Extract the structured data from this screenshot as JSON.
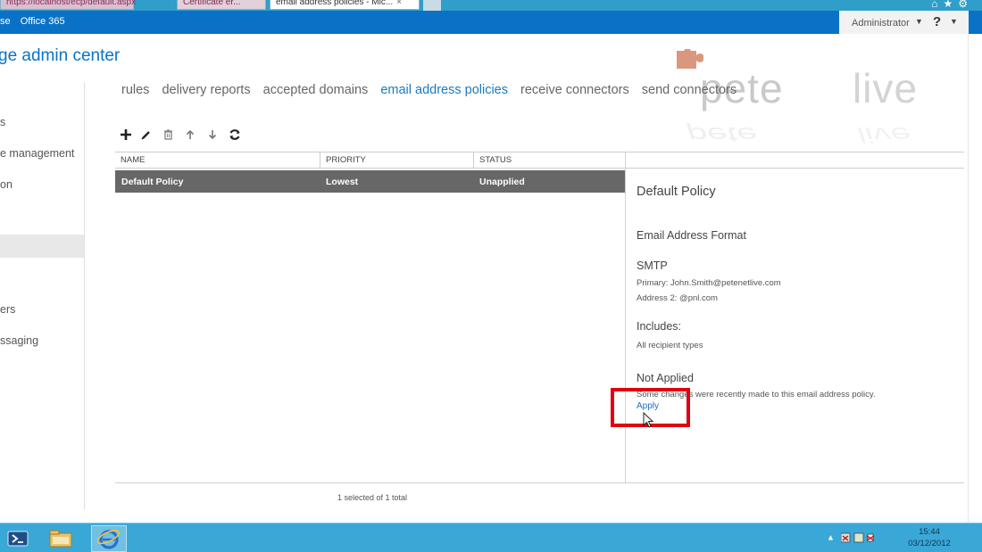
{
  "browser": {
    "tabs": [
      {
        "label": "https://localhost/ecp/default.aspx"
      },
      {
        "label": "Certificate er..."
      },
      {
        "label": "email address policies - Mic..."
      }
    ]
  },
  "topbar": {
    "nav": [
      "se",
      "Office 365"
    ],
    "user": "Administrator",
    "help": "?"
  },
  "app_title": "ge admin center",
  "leftnav": {
    "items": [
      "s",
      "e management",
      "on",
      "ers",
      "ssaging"
    ]
  },
  "subtabs": {
    "items": [
      "rules",
      "delivery reports",
      "accepted domains",
      "email address policies",
      "receive connectors",
      "send connectors"
    ],
    "active_index": 3
  },
  "watermark": {
    "word1": "pete",
    "word2": "live",
    "reflection1": "pete",
    "reflection2": "live"
  },
  "toolbar": {
    "icons": [
      "add-icon",
      "edit-icon",
      "delete-icon",
      "move-up-icon",
      "move-down-icon",
      "refresh-icon"
    ]
  },
  "list": {
    "columns": [
      "NAME",
      "PRIORITY",
      "STATUS"
    ],
    "rows": [
      {
        "name": "Default Policy",
        "priority": "Lowest",
        "status": "Unapplied"
      }
    ],
    "status_text": "1 selected of 1 total"
  },
  "details": {
    "title": "Default Policy",
    "format_heading": "Email Address Format",
    "smtp_heading": "SMTP",
    "primary": "Primary: John.Smith@petenetlive.com",
    "address2": "Address 2: @pnl.com",
    "includes_heading": "Includes:",
    "includes_value": "All recipient types",
    "state_heading": "Not Applied",
    "state_message": "Some changes were recently made to this email address policy.",
    "apply_link": "Apply"
  },
  "taskbar": {
    "time": "15:44",
    "date": "03/12/2012"
  },
  "colors": {
    "office_blue": "#0a72c6",
    "link_blue": "#1a7ac4",
    "selected_row": "#676767",
    "highlight_red": "#e0000f",
    "taskbar": "#3aa8d7"
  }
}
